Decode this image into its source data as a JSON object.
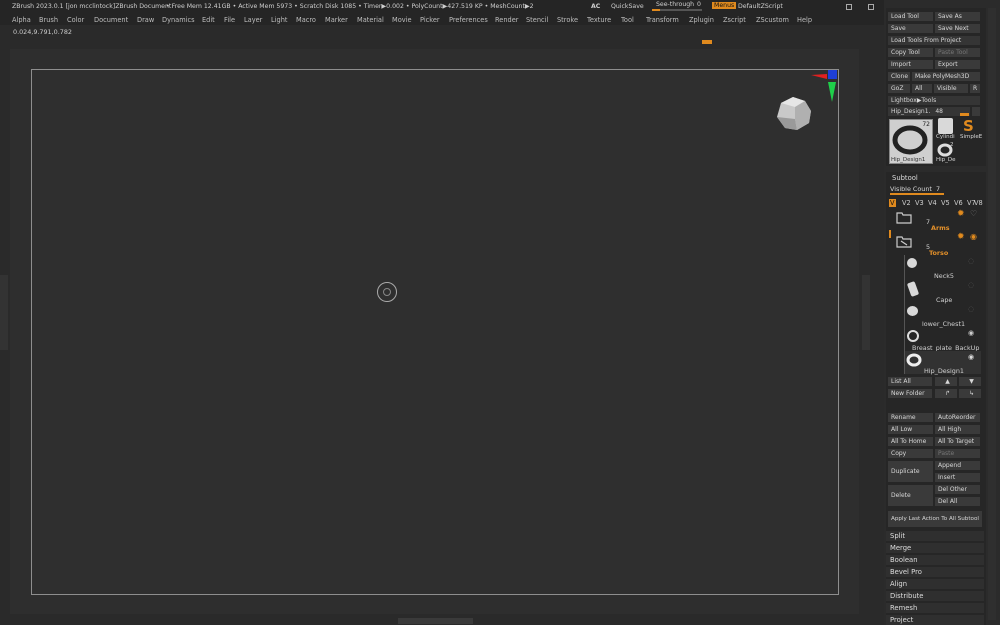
{
  "titlebar": {
    "app_title": "ZBrush 2023.0.1 [jon mcclintock]ZBrush Document",
    "stats": "• Free Mem 12.41GB • Active Mem 5973 • Scratch Disk 1085 • Timer▶0.002 • PolyCount▶427.519 KP • MeshCount▶2",
    "ac": "AC",
    "quicksave": "QuickSave",
    "see_through": "See-through",
    "see_through_value": "0",
    "menus": "Menus",
    "default_zscript": "DefaultZScript"
  },
  "menus": [
    "Alpha",
    "Brush",
    "Color",
    "Document",
    "Draw",
    "Dynamics",
    "Edit",
    "File",
    "Layer",
    "Light",
    "Macro",
    "Marker",
    "Material",
    "Movie",
    "Picker",
    "Preferences",
    "Render",
    "Stencil",
    "Stroke",
    "Texture",
    "Tool",
    "Transform",
    "Zplugin",
    "Zscript",
    "ZScustom",
    "Help"
  ],
  "coords": "0.024,9.791,0.782",
  "tool": {
    "load_tool": "Load Tool",
    "save_as": "Save As",
    "save": "Save",
    "save_next": "Save Next",
    "load_tools_from_project": "Load Tools From Project",
    "copy_tool": "Copy Tool",
    "paste_tool": "Paste Tool",
    "import": "Import",
    "export": "Export",
    "clone": "Clone",
    "make_polymesh": "Make PolyMesh3D",
    "goz": "GoZ",
    "all": "All",
    "visible": "Visible",
    "r": "R",
    "lightbox_tools": "Lightbox▶Tools",
    "current_tool": "Hip_Design1.",
    "current_tool_value": "48",
    "thumb_count": "72",
    "thumb_label_1": "Hip_Design1",
    "thumb_label_2": "Cylindi",
    "thumb_label_3": "SimpleE",
    "thumb_label_4": "Hip_De",
    "thumb_count_4": "2"
  },
  "subtool": {
    "header": "Subtool",
    "visible_count_label": "Visible Count",
    "visible_count": "7",
    "versions": [
      "V2",
      "V3",
      "V4",
      "V5",
      "V6",
      "V7",
      "V8"
    ],
    "folders": [
      {
        "count": "7",
        "name": "Arms"
      },
      {
        "count": "5",
        "name": "Torso"
      }
    ],
    "items": [
      "Neck5",
      "Cape",
      "lower_Chest1",
      "Breast_plate_BackUp",
      "Hip_Design1"
    ],
    "list_all": "List All",
    "new_folder": "New Folder",
    "rename": "Rename",
    "autoreorder": "AutoReorder",
    "all_low": "All Low",
    "all_high": "All High",
    "all_to_home": "All To Home",
    "all_to_target": "All To Target",
    "copy": "Copy",
    "paste": "Paste",
    "duplicate": "Duplicate",
    "append": "Append",
    "insert": "Insert",
    "delete": "Delete",
    "del_other": "Del Other",
    "del_all": "Del All",
    "apply_last": "Apply Last Action To All Subtool",
    "sections": [
      "Split",
      "Merge",
      "Boolean",
      "Bevel Pro",
      "Align",
      "Distribute",
      "Remesh",
      "Project"
    ]
  },
  "colors": {
    "accent": "#e08a1e",
    "gizmo_red": "#e02020",
    "gizmo_green": "#1fd04a",
    "gizmo_blue": "#1e3fd8"
  }
}
